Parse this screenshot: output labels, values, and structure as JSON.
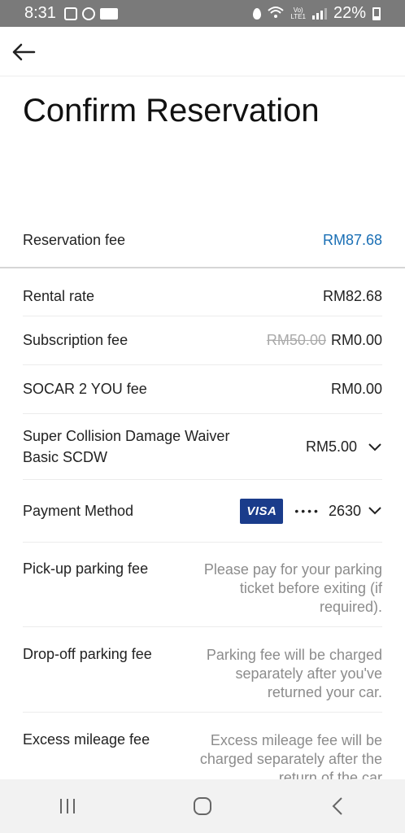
{
  "status_bar": {
    "time": "8:31",
    "battery": "22%",
    "volte": "Vo)\nLTE1"
  },
  "title": "Confirm Reservation",
  "reservation_fee": {
    "label": "Reservation fee",
    "amount": "RM87.68"
  },
  "rows": {
    "rental_rate": {
      "label": "Rental rate",
      "value": "RM82.68"
    },
    "subscription_fee": {
      "label": "Subscription fee",
      "original": "RM50.00",
      "value": "RM0.00"
    },
    "socar_2_you_fee": {
      "label": "SOCAR 2 YOU fee",
      "value": "RM0.00"
    },
    "scdw": {
      "label_line1": "Super Collision Damage Waiver",
      "label_line2": "Basic SCDW",
      "value": "RM5.00"
    },
    "payment_method": {
      "label": "Payment Method",
      "card_brand": "VISA",
      "masked": "••••",
      "last4": "2630"
    },
    "pickup_parking": {
      "label": "Pick-up parking fee",
      "note": "Please pay for your parking ticket before exiting (if required)."
    },
    "dropoff_parking": {
      "label": "Drop-off parking fee",
      "note": "Parking fee will be charged separately after you've returned your car."
    },
    "excess_mileage": {
      "label": "Excess mileage fee",
      "note": "Excess mileage fee will be charged separately after the return of the car"
    }
  },
  "colors": {
    "accent": "#1a6fb5",
    "visa": "#1a3c8b",
    "status_bar": "#7a7a7a"
  },
  "icons": {
    "back": "arrow-left-icon",
    "chevron": "chevron-down-icon",
    "nav_recents": "recents-icon",
    "nav_home": "home-icon",
    "nav_back": "back-chevron-icon"
  }
}
